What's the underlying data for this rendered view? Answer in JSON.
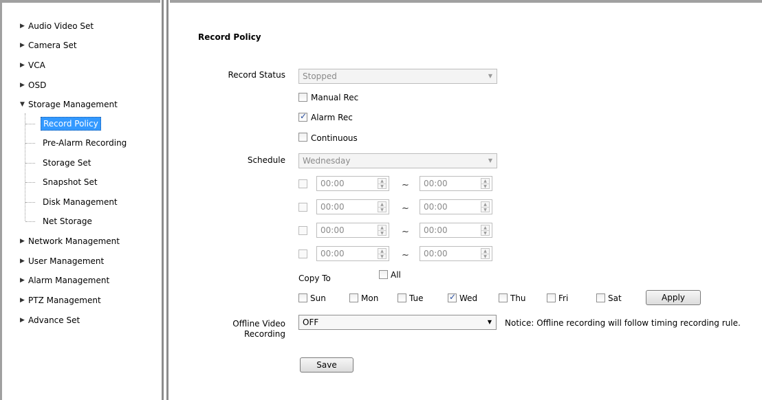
{
  "sidebar": {
    "items": [
      {
        "label": "Audio Video Set",
        "expanded": false
      },
      {
        "label": "Camera Set",
        "expanded": false
      },
      {
        "label": "VCA",
        "expanded": false
      },
      {
        "label": "OSD",
        "expanded": false
      },
      {
        "label": "Storage Management",
        "expanded": true
      },
      {
        "label": "Network Management",
        "expanded": false
      },
      {
        "label": "User Management",
        "expanded": false
      },
      {
        "label": "Alarm Management",
        "expanded": false
      },
      {
        "label": "PTZ Management",
        "expanded": false
      },
      {
        "label": "Advance Set",
        "expanded": false
      }
    ],
    "storage_children": [
      {
        "label": "Record Policy",
        "active": true
      },
      {
        "label": "Pre-Alarm Recording",
        "active": false
      },
      {
        "label": "Storage Set",
        "active": false
      },
      {
        "label": "Snapshot Set",
        "active": false
      },
      {
        "label": "Disk Management",
        "active": false
      },
      {
        "label": "Net Storage",
        "active": false
      }
    ]
  },
  "main": {
    "title": "Record Policy",
    "record_status": {
      "label": "Record Status",
      "value": "Stopped"
    },
    "modes": [
      {
        "label": "Manual Rec",
        "checked": false
      },
      {
        "label": "Alarm Rec",
        "checked": true
      },
      {
        "label": "Continuous",
        "checked": false
      }
    ],
    "schedule": {
      "label": "Schedule",
      "day": "Wednesday",
      "separator": "~",
      "rows": [
        {
          "enabled": false,
          "start": "00:00",
          "end": "00:00"
        },
        {
          "enabled": false,
          "start": "00:00",
          "end": "00:00"
        },
        {
          "enabled": false,
          "start": "00:00",
          "end": "00:00"
        },
        {
          "enabled": false,
          "start": "00:00",
          "end": "00:00"
        }
      ]
    },
    "copy_to": {
      "label": "Copy To",
      "all_label": "All",
      "all_checked": false,
      "days": [
        {
          "label": "Sun",
          "checked": false
        },
        {
          "label": "Mon",
          "checked": false
        },
        {
          "label": "Tue",
          "checked": false
        },
        {
          "label": "Wed",
          "checked": true
        },
        {
          "label": "Thu",
          "checked": false
        },
        {
          "label": "Fri",
          "checked": false
        },
        {
          "label": "Sat",
          "checked": false
        }
      ],
      "apply_label": "Apply"
    },
    "offline": {
      "label_line1": "Offline Video",
      "label_line2": "Recording",
      "value": "OFF",
      "notice": "Notice: Offline recording will follow timing recording rule."
    },
    "save_label": "Save"
  }
}
